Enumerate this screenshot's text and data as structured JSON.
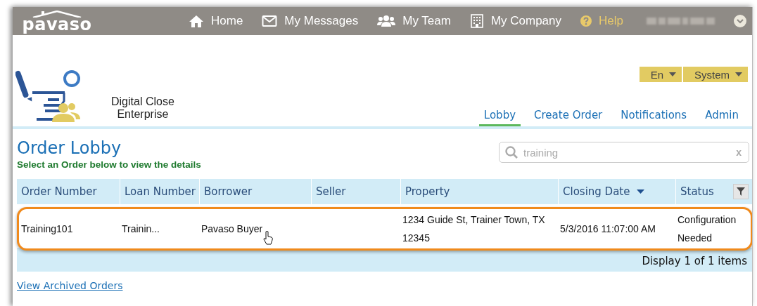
{
  "topbar": {
    "logo": "pavaso",
    "nav": [
      {
        "label": "Home",
        "kind": "home"
      },
      {
        "label": "My Messages",
        "kind": "mail"
      },
      {
        "label": "My Team",
        "kind": "team"
      },
      {
        "label": "My Company",
        "kind": "building"
      },
      {
        "label": "Help",
        "kind": "help"
      }
    ]
  },
  "header": {
    "product_name": "Digital Close",
    "product_subtitle": "Enterprise",
    "menus": [
      "En",
      "System"
    ],
    "tabs": [
      {
        "label": "Lobby",
        "selected": true
      },
      {
        "label": "Create Order",
        "selected": false
      },
      {
        "label": "Notifications",
        "selected": false
      },
      {
        "label": "Admin",
        "selected": false
      }
    ]
  },
  "lobby": {
    "title": "Order Lobby",
    "subtitle": "Select an Order below to view the details",
    "search": {
      "value": "training",
      "clear_button": "x"
    },
    "table": {
      "columns": [
        {
          "label": "Order Number",
          "sorted": false,
          "filter": false
        },
        {
          "label": "Loan Number",
          "sorted": false,
          "filter": false
        },
        {
          "label": "Borrower",
          "sorted": false,
          "filter": false
        },
        {
          "label": "Seller",
          "sorted": false,
          "filter": false
        },
        {
          "label": "Property",
          "sorted": false,
          "filter": false
        },
        {
          "label": "Closing Date",
          "sorted": true,
          "filter": false
        },
        {
          "label": "Status",
          "sorted": false,
          "filter": true
        }
      ],
      "rows": [
        [
          "Training101",
          "Trainin...",
          "Pavaso Buyer",
          null,
          "1234 Guide St, Trainer Town, TX 12345",
          "5/3/2016 11:07:00 AM",
          "Configuration Needed"
        ]
      ]
    },
    "pager": "Display 1 of 1 items",
    "archive_link": "View Archived Orders"
  }
}
